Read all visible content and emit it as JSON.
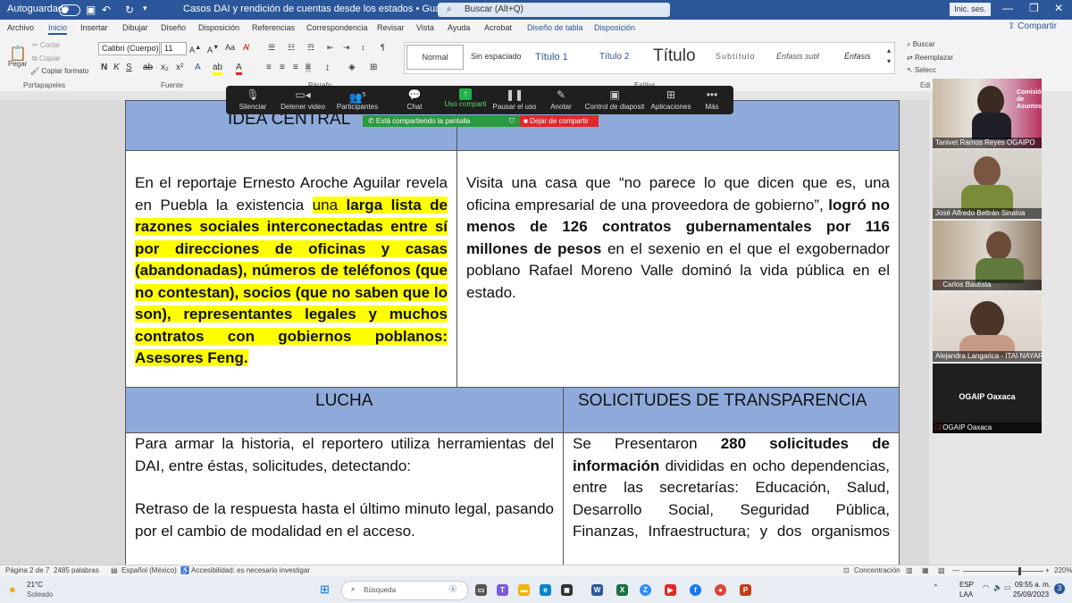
{
  "titlebar": {
    "autosave_label": "Autoguardado",
    "document_title": "Casos DAI y rendición de cuentas desde los estados • Guardado en Este PC",
    "search_placeholder": "Buscar (Alt+Q)",
    "sign_in": "Inic. ses."
  },
  "tabs": [
    "Archivo",
    "Inicio",
    "Insertar",
    "Dibujar",
    "Diseño",
    "Disposición",
    "Referencias",
    "Correspondencia",
    "Revisar",
    "Vista",
    "Ayuda",
    "Acrobat",
    "Diseño de tabla",
    "Disposición"
  ],
  "share_label": "Compartir",
  "ribbon": {
    "paste": "Pegar",
    "cut": "Cortar",
    "copy": "Copiar",
    "format_painter": "Copiar formato",
    "clipboard_group": "Portapapeles",
    "font_name": "Calibri (Cuerpo)",
    "font_size": "11",
    "font_group": "Fuente",
    "paragraph_group": "Párrafo",
    "styles_group": "Estilos",
    "styles": [
      "Normal",
      "Sin espaciado",
      "Título 1",
      "Título 2",
      "Título",
      "Subtítulo",
      "Énfasis sutil",
      "Énfasis"
    ],
    "find": "Buscar",
    "replace": "Reemplazar",
    "select": "Selecc",
    "edit_group": "Edi"
  },
  "zoom": {
    "controls": [
      {
        "label": "Silenciar",
        "icon": "microphone-icon"
      },
      {
        "label": "Detener video",
        "icon": "video-camera-icon"
      },
      {
        "label": "Participantes",
        "icon": "participants-icon",
        "count": "5"
      },
      {
        "label": "Chat",
        "icon": "chat-icon"
      },
      {
        "label": "Uso comparti",
        "icon": "share-screen-icon"
      },
      {
        "label": "Pausar el uso",
        "icon": "pause-icon"
      },
      {
        "label": "Anotar",
        "icon": "pen-icon"
      },
      {
        "label": "Control de diaposit",
        "icon": "slide-control-icon"
      },
      {
        "label": "Aplicaciones",
        "icon": "apps-icon"
      },
      {
        "label": "Más",
        "icon": "more-icon"
      }
    ],
    "sharing_banner": "Está compartiendo la pantalla",
    "stop_sharing": "Dejar de compartir"
  },
  "doc": {
    "idea_header": "IDEA CENTRAL",
    "idea_left_plain": "En el reportaje Ernesto Aroche Aguilar revela en Puebla la existencia ",
    "idea_left_hl1": "una ",
    "idea_left_hl_bold": "larga lista de razones sociales interconectadas entre sí por direcciones de oficinas y casas (abandonadas), números de teléfonos (que no contestan), socios (que no saben que lo son), representantes legales y muchos contratos con gobiernos poblanos: Asesores Feng.",
    "idea_right_plain1": "Visita una casa que “no parece lo que dicen que es, una oficina empresarial de una proveedora de gobierno”, ",
    "idea_right_bold": "logró no menos de 126 contratos gubernamentales por 116 millones de pesos",
    "idea_right_plain2": " en el sexenio en el que el exgobernador poblano Rafael Moreno Valle dominó la vida pública en el estado.",
    "lucha_header": "LUCHA",
    "solicitudes_header": "SOLICITUDES DE TRANSPARENCIA",
    "lucha_p1": "Para armar la historia, el reportero utiliza herramientas del DAI, entre éstas, solicitudes, detectando:",
    "lucha_p2": "Retraso de la respuesta hasta el último minuto legal, pasando por el cambio de modalidad en el acceso.",
    "sol_plain1": "Se Presentaron ",
    "sol_bold": "280 solicitudes de información",
    "sol_plain2": " divididas en ocho dependencias, entre las secretarías: Educación, Salud, Desarrollo Social, Seguridad Pública, Finanzas, Infraestructura; y dos organismos"
  },
  "participants": [
    {
      "name": "Tanivet Ramos Reyes OGAIPO",
      "muted": false
    },
    {
      "name": "José Alfredo Beltrán Sinaloa",
      "muted": false
    },
    {
      "name": "Carlos Bautista",
      "muted": true
    },
    {
      "name": "Alejandra Langarica - ITAI NAYARIT",
      "muted": false
    },
    {
      "name": "OGAIP Oaxaca",
      "title": "OGAIP Oaxaca",
      "muted": true
    }
  ],
  "participant_banner": "Comisión de Asuntos",
  "status": {
    "page": "Página 2 de 7",
    "words": "2485 palabras",
    "language": "Español (México)",
    "accessibility": "Accesibilidad: es necesario investigar",
    "focus": "Concentración",
    "zoom": "220%"
  },
  "taskbar": {
    "temperature": "21°C",
    "weather": "Soleado",
    "search_placeholder": "Búsqueda",
    "lang1": "ESP",
    "lang2": "LAA",
    "time": "09:55 a. m.",
    "date": "25/09/2023",
    "notif_count": "3"
  },
  "colors": {
    "word_blue": "#2b579a",
    "table_header": "#8eaadb",
    "highlight": "#ffff00",
    "zoom_green": "#22b14c",
    "stop_red": "#e02828"
  }
}
